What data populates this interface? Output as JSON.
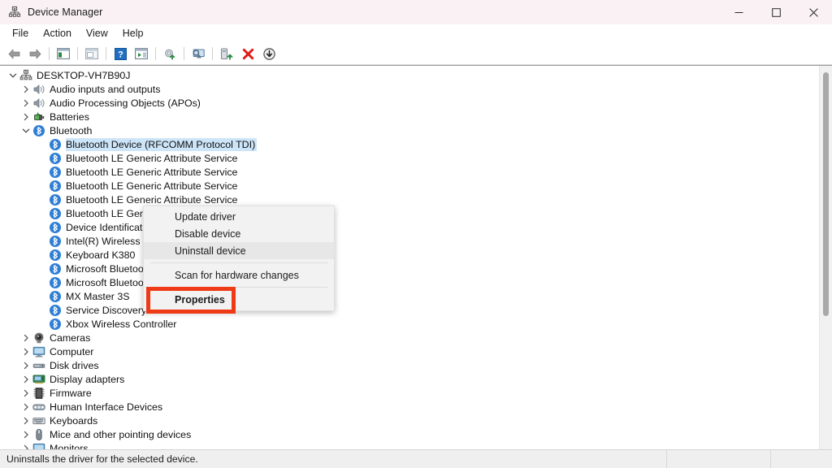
{
  "window": {
    "title": "Device Manager",
    "icon": "device-manager-icon",
    "controls": [
      {
        "name": "minimize-button",
        "glyph": "minimize-icon"
      },
      {
        "name": "maximize-button",
        "glyph": "maximize-icon"
      },
      {
        "name": "close-button",
        "glyph": "close-icon"
      }
    ]
  },
  "menubar": {
    "items": [
      {
        "label": "File"
      },
      {
        "label": "Action"
      },
      {
        "label": "View"
      },
      {
        "label": "Help"
      }
    ]
  },
  "toolbar": {
    "buttons": [
      {
        "name": "back-button",
        "icon": "back-arrow-icon"
      },
      {
        "name": "forward-button",
        "icon": "forward-arrow-icon"
      },
      {
        "name": "separator-1",
        "icon": "separator"
      },
      {
        "name": "show-hide-console-tree-button",
        "icon": "console-tree-icon"
      },
      {
        "name": "separator-2",
        "icon": "separator"
      },
      {
        "name": "properties-button",
        "icon": "properties-window-icon"
      },
      {
        "name": "separator-3",
        "icon": "separator"
      },
      {
        "name": "help-button",
        "icon": "help-question-icon"
      },
      {
        "name": "view-button",
        "icon": "view-panel-icon"
      },
      {
        "name": "separator-4",
        "icon": "separator"
      },
      {
        "name": "update-driver-button",
        "icon": "update-driver-icon"
      },
      {
        "name": "separator-5",
        "icon": "separator"
      },
      {
        "name": "scan-hardware-changes-button",
        "icon": "scan-monitor-icon"
      },
      {
        "name": "separator-6",
        "icon": "separator"
      },
      {
        "name": "enable-device-button",
        "icon": "enable-device-icon"
      },
      {
        "name": "uninstall-device-button",
        "icon": "red-x-icon"
      },
      {
        "name": "add-legacy-hardware-button",
        "icon": "down-arrow-circle-icon"
      }
    ]
  },
  "tree": {
    "nodes": [
      {
        "label": "DESKTOP-VH7B90J",
        "indent": 0,
        "expander": "expanded",
        "icon": "computer-root-icon",
        "selected": false
      },
      {
        "label": "Audio inputs and outputs",
        "indent": 1,
        "expander": "collapsed",
        "icon": "speaker-icon",
        "selected": false
      },
      {
        "label": "Audio Processing Objects (APOs)",
        "indent": 1,
        "expander": "collapsed",
        "icon": "speaker-icon",
        "selected": false
      },
      {
        "label": "Batteries",
        "indent": 1,
        "expander": "collapsed",
        "icon": "battery-icon",
        "selected": false
      },
      {
        "label": "Bluetooth",
        "indent": 1,
        "expander": "expanded",
        "icon": "bluetooth-icon",
        "selected": false
      },
      {
        "label": "Bluetooth Device (RFCOMM Protocol TDI)",
        "indent": 2,
        "expander": "none",
        "icon": "bluetooth-icon",
        "selected": true
      },
      {
        "label": "Bluetooth LE Generic Attribute Service",
        "indent": 2,
        "expander": "none",
        "icon": "bluetooth-icon",
        "selected": false
      },
      {
        "label": "Bluetooth LE Generic Attribute Service",
        "indent": 2,
        "expander": "none",
        "icon": "bluetooth-icon",
        "selected": false
      },
      {
        "label": "Bluetooth LE Generic Attribute Service",
        "indent": 2,
        "expander": "none",
        "icon": "bluetooth-icon",
        "selected": false
      },
      {
        "label": "Bluetooth LE Generic Attribute Service",
        "indent": 2,
        "expander": "none",
        "icon": "bluetooth-icon",
        "selected": false
      },
      {
        "label": "Bluetooth LE Generic Attribute Service",
        "indent": 2,
        "expander": "none",
        "icon": "bluetooth-icon",
        "selected": false
      },
      {
        "label": "Device Identification Service",
        "indent": 2,
        "expander": "none",
        "icon": "bluetooth-icon",
        "selected": false
      },
      {
        "label": "Intel(R) Wireless Bluetooth(R)",
        "indent": 2,
        "expander": "none",
        "icon": "bluetooth-icon",
        "selected": false
      },
      {
        "label": "Keyboard K380",
        "indent": 2,
        "expander": "none",
        "icon": "bluetooth-icon",
        "selected": false
      },
      {
        "label": "Microsoft Bluetooth Enumerator",
        "indent": 2,
        "expander": "none",
        "icon": "bluetooth-icon",
        "selected": false
      },
      {
        "label": "Microsoft Bluetooth LE Enumerator",
        "indent": 2,
        "expander": "none",
        "icon": "bluetooth-icon",
        "selected": false
      },
      {
        "label": "MX Master 3S",
        "indent": 2,
        "expander": "none",
        "icon": "bluetooth-icon",
        "selected": false
      },
      {
        "label": "Service Discovery Service",
        "indent": 2,
        "expander": "none",
        "icon": "bluetooth-icon",
        "selected": false
      },
      {
        "label": "Xbox Wireless Controller",
        "indent": 2,
        "expander": "none",
        "icon": "bluetooth-icon",
        "selected": false
      },
      {
        "label": "Cameras",
        "indent": 1,
        "expander": "collapsed",
        "icon": "camera-icon",
        "selected": false
      },
      {
        "label": "Computer",
        "indent": 1,
        "expander": "collapsed",
        "icon": "monitor-icon",
        "selected": false
      },
      {
        "label": "Disk drives",
        "indent": 1,
        "expander": "collapsed",
        "icon": "disk-drive-icon",
        "selected": false
      },
      {
        "label": "Display adapters",
        "indent": 1,
        "expander": "collapsed",
        "icon": "display-adapter-icon",
        "selected": false
      },
      {
        "label": "Firmware",
        "indent": 1,
        "expander": "collapsed",
        "icon": "firmware-chip-icon",
        "selected": false
      },
      {
        "label": "Human Interface Devices",
        "indent": 1,
        "expander": "collapsed",
        "icon": "hid-icon",
        "selected": false
      },
      {
        "label": "Keyboards",
        "indent": 1,
        "expander": "collapsed",
        "icon": "keyboard-icon",
        "selected": false
      },
      {
        "label": "Mice and other pointing devices",
        "indent": 1,
        "expander": "collapsed",
        "icon": "mouse-icon",
        "selected": false
      },
      {
        "label": "Monitors",
        "indent": 1,
        "expander": "collapsed",
        "icon": "monitor-icon",
        "selected": false
      }
    ]
  },
  "context_menu": {
    "items": [
      {
        "label": "Update driver",
        "state": "normal"
      },
      {
        "label": "Disable device",
        "state": "normal"
      },
      {
        "label": "Uninstall device",
        "state": "highlighted"
      },
      {
        "label": "Scan for hardware changes",
        "state": "normal"
      },
      {
        "label": "Properties",
        "state": "bold"
      }
    ]
  },
  "annotation": {
    "target": "Properties",
    "color": "#ef3a17"
  },
  "statusbar": {
    "message": "Uninstalls the driver for the selected device."
  },
  "colors": {
    "titlebar_bg": "#f9f1f3",
    "selection_bg": "#cde5f8",
    "bluetooth_blue": "#2f7fd6",
    "annotation_red": "#ef3a17",
    "menu_bg": "#f2f2f2",
    "menu_highlight": "#e7e7e7",
    "statusbar_bg": "#efefef"
  }
}
